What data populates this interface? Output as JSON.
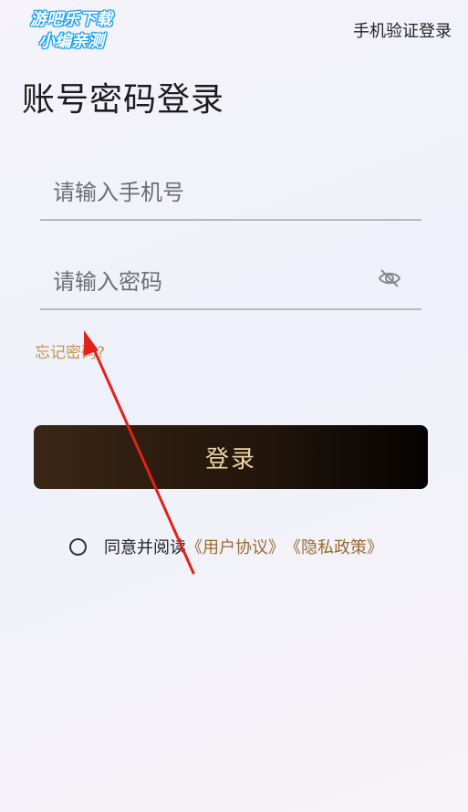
{
  "watermark": {
    "line1": "游吧乐下载",
    "line2": "小编亲测"
  },
  "header": {
    "switch_link": "手机验证登录",
    "title": "账号密码登录"
  },
  "form": {
    "phone_placeholder": "请输入手机号",
    "password_placeholder": "请输入密码",
    "forgot_link": "忘记密码?",
    "login_label": "登录"
  },
  "agreement": {
    "text": "同意并阅读",
    "user_agreement": "《用户协议》",
    "privacy_policy": "《隐私政策》"
  },
  "colors": {
    "accent_gold": "#c7924c",
    "link_brown": "#9a6a32",
    "button_dark": "#21140b",
    "annotation_red": "#e0221b"
  },
  "icons": {
    "password_toggle": "eye-off-icon",
    "agree_radio": "radio-unchecked-icon"
  }
}
